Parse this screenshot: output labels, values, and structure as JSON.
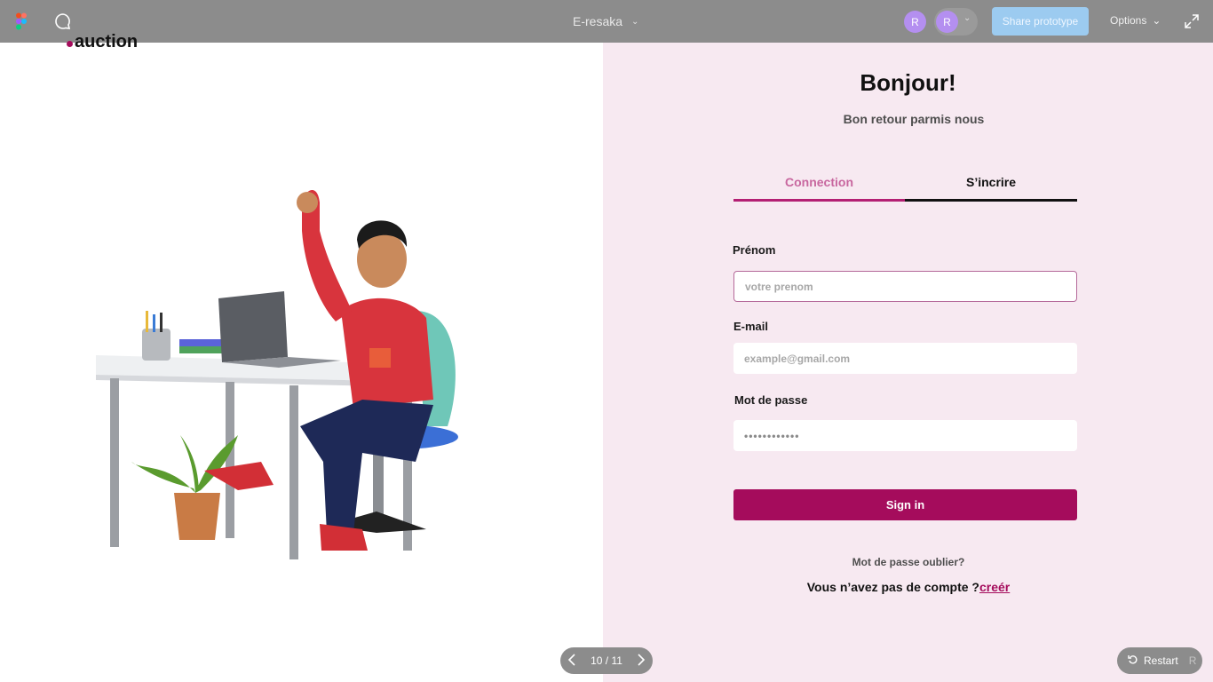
{
  "topbar": {
    "file_title": "E-resaka",
    "avatars": [
      "R",
      "R"
    ],
    "share_label": "Share prototype",
    "options_label": "Options"
  },
  "logo": {
    "text": "auction",
    "dot_color": "#a50c5c"
  },
  "form": {
    "greeting": "Bonjour!",
    "subtitle": "Bon retour parmis nous",
    "tabs": [
      {
        "label": "Connection",
        "active": true
      },
      {
        "label": "S’incrire",
        "active": false
      }
    ],
    "firstname_label": "Prénom",
    "firstname_placeholder": "votre prenom",
    "email_label": "E-mail",
    "email_placeholder": "example@gmail.com",
    "password_label": "Mot de passe",
    "password_value": "••••••••••••",
    "signin_label": "Sign in",
    "forgot_label": "Mot de passe oublier?",
    "no_account_text": "Vous n’avez pas de compte ?",
    "create_link": "creér"
  },
  "pager": {
    "label": "10 / 11"
  },
  "restart": {
    "label": "Restart",
    "shortcut": "R"
  },
  "colors": {
    "accent": "#a50c5c",
    "panel_bg": "#f7e9f1",
    "tab_active": "#c8679f",
    "topbar": "#8c8c8c"
  }
}
